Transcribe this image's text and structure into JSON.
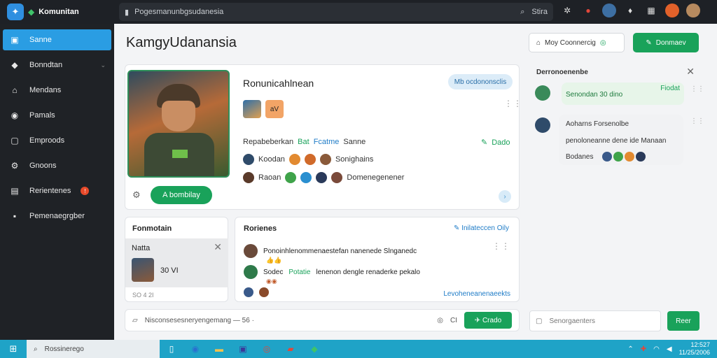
{
  "colors": {
    "accent_green": "#19a25a",
    "accent_blue": "#2a9de3",
    "dark": "#1e2126"
  },
  "brand": {
    "name": "Komunitan",
    "logo_icon": "app-logo-icon"
  },
  "url_bar": {
    "text": "Pogesmanunbgsudanesia",
    "search_label": "Stira"
  },
  "sidebar": {
    "items": [
      {
        "label": "Sanne",
        "icon": "home-icon"
      },
      {
        "label": "Bonndtan",
        "icon": "shield-icon"
      },
      {
        "label": "Mendans",
        "icon": "house-icon"
      },
      {
        "label": "Pamals",
        "icon": "circle-icon"
      },
      {
        "label": "Emproods",
        "icon": "square-icon"
      },
      {
        "label": "Gnoons",
        "icon": "gear-icon"
      },
      {
        "label": "Rerientenes",
        "icon": "book-icon"
      },
      {
        "label": "Pemenaegrgber",
        "icon": "box-icon"
      }
    ]
  },
  "header": {
    "title": "KamgyUdanansia",
    "outline_button": "Moy Coonnercig",
    "green_button": "Donmaev"
  },
  "profile": {
    "name": "Ronunicahlnean",
    "mini_label": "aV",
    "tag": "Mb ocdononsclis",
    "line1_prefix": "Repabeberkan",
    "line1_green": "Bat",
    "line1_blue": "Fcatme",
    "line1_suffix": "Sanne",
    "line1_right": "Dado",
    "line2_a": "Koodan",
    "line2_b": "Sonighains",
    "line3_a": "Raoan",
    "line3_b": "Domenegenener",
    "cta": "A bombilay"
  },
  "friends": {
    "title": "Fonmotain",
    "popup_name": "Natta",
    "popup_value": "30 VI",
    "footer": "SO 4 2I"
  },
  "activity": {
    "title": "Rorienes",
    "link": "Inilateccen Oily",
    "row1": "Ponoinhlenommenaestefan nanenede Slnganedc",
    "row2_a": "Sodec",
    "row2_b": "Potatie",
    "row2_c": "lenenon dengle renaderke pekalo",
    "more": "Levoheneanenaeekts"
  },
  "composer": {
    "text": "Nisconsesesneryengemang — 56 ·",
    "count": "CI",
    "send": "Crado"
  },
  "chat": {
    "title": "Derronoenenbe",
    "msg1": "Senondan 30 dino",
    "msg1_time": "Fiodat",
    "msg2_name": "Aoharns Forsenolbe",
    "msg2_text": "penoloneanne dene ide Manaan",
    "msg2_sub": "Bodanes",
    "input_placeholder": "Senorgaenters",
    "send": "Reer"
  },
  "taskbar": {
    "search": "Rossinerego",
    "time": "12:527",
    "date": "11/25/2006"
  }
}
